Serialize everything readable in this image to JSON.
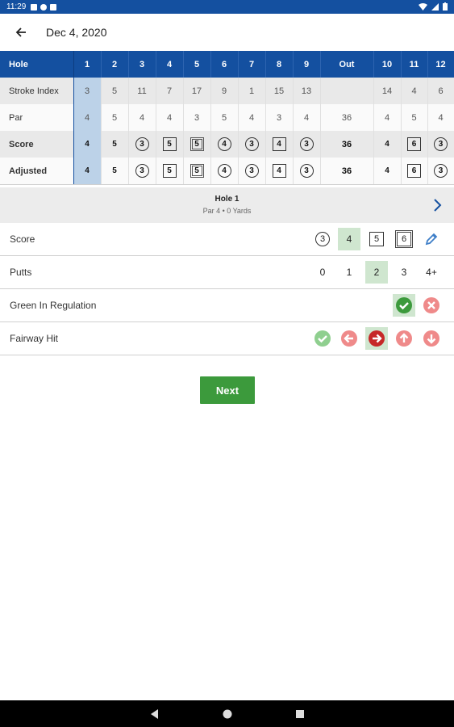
{
  "status_bar": {
    "time": "11:29"
  },
  "header": {
    "title": "Dec 4, 2020"
  },
  "scorecard": {
    "columns": [
      "Hole",
      "1",
      "2",
      "3",
      "4",
      "5",
      "6",
      "7",
      "8",
      "9",
      "Out",
      "10",
      "11",
      "12"
    ],
    "rows": [
      {
        "label": "Stroke Index",
        "cells": [
          "3",
          "5",
          "11",
          "7",
          "17",
          "9",
          "1",
          "15",
          "13",
          "",
          "14",
          "4",
          "6"
        ]
      },
      {
        "label": "Par",
        "cells": [
          "4",
          "5",
          "4",
          "4",
          "3",
          "5",
          "4",
          "3",
          "4",
          "36",
          "4",
          "5",
          "4"
        ]
      },
      {
        "label": "Score",
        "cells": [
          "4",
          "5",
          "3",
          "5",
          "5",
          "4",
          "3",
          "4",
          "3",
          "36",
          "4",
          "6",
          "3"
        ]
      },
      {
        "label": "Adjusted",
        "cells": [
          "4",
          "5",
          "3",
          "5",
          "5",
          "4",
          "3",
          "4",
          "3",
          "36",
          "4",
          "6",
          "3"
        ]
      }
    ]
  },
  "hole_info": {
    "title": "Hole 1",
    "subtitle": "Par 4 • 0 Yards"
  },
  "entry": {
    "score": {
      "label": "Score",
      "options": [
        "3",
        "4",
        "5",
        "6"
      ],
      "selected": "4"
    },
    "putts": {
      "label": "Putts",
      "options": [
        "0",
        "1",
        "2",
        "3",
        "4+"
      ],
      "selected": "2"
    },
    "gir": {
      "label": "Green In Regulation",
      "selected": "yes"
    },
    "fairway": {
      "label": "Fairway Hit",
      "selected": "right"
    }
  },
  "next_label": "Next",
  "colors": {
    "header_blue": "#1450a0",
    "green": "#3c9a3c",
    "red": "#e05a5a",
    "select_bg": "#cfe6cf"
  }
}
